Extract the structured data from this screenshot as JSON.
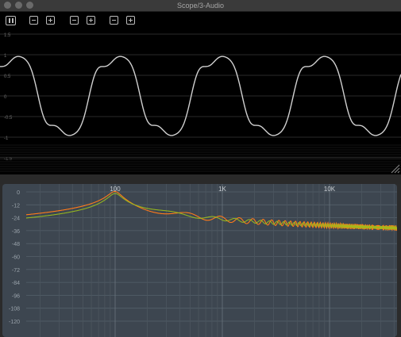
{
  "window": {
    "title": "Scope/3-Audio"
  },
  "scope": {
    "y_labels": [
      "1.5",
      "1",
      "0.5",
      "0",
      "-0.5",
      "-1",
      "-1.5"
    ]
  },
  "spectrum": {
    "x_labels": [
      "100",
      "1K",
      "10K"
    ],
    "y_labels": [
      "0",
      "-12",
      "-24",
      "-36",
      "-48",
      "-60",
      "-72",
      "-84",
      "-96",
      "-108",
      "-120"
    ]
  },
  "colors": {
    "scope_bg": "#000000",
    "waveform": "#d0d0d0",
    "spectrum_bg": "#3d4650",
    "channel_1": "#ff7a1a",
    "channel_2": "#9bbf1c"
  },
  "icons": [
    "pause-icon",
    "minus-icon",
    "plus-icon"
  ]
}
